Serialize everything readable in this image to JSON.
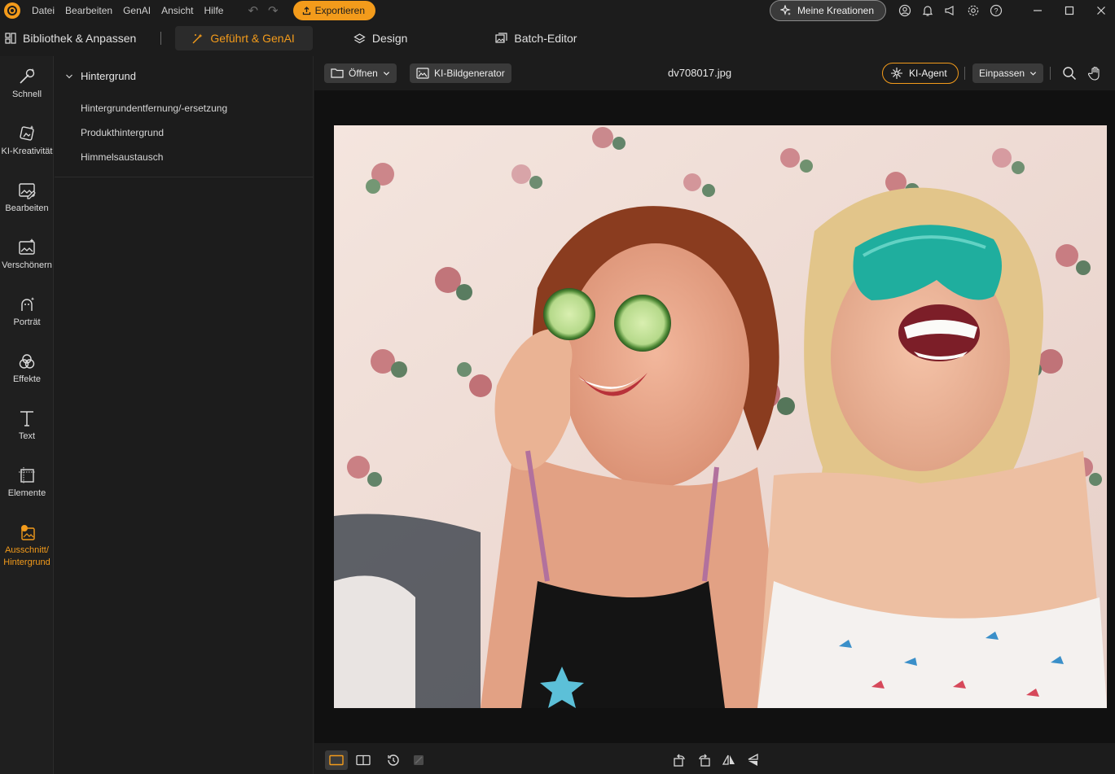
{
  "titlebar": {
    "menu": [
      "Datei",
      "Bearbeiten",
      "GenAI",
      "Ansicht",
      "Hilfe"
    ],
    "export_label": "Exportieren",
    "kreationen_label": "Meine Kreationen"
  },
  "tabs": {
    "library": "Bibliothek & Anpassen",
    "guided": "Geführt & GenAI",
    "design": "Design",
    "batch": "Batch-Editor"
  },
  "rail": {
    "items": [
      {
        "label": "Schnell",
        "icon": "magic-wand-icon"
      },
      {
        "label": "KI-Kreativität",
        "icon": "ai-creativity-icon"
      },
      {
        "label": "Bearbeiten",
        "icon": "edit-image-icon"
      },
      {
        "label": "Verschönern",
        "icon": "beautify-icon"
      },
      {
        "label": "Porträt",
        "icon": "portrait-icon"
      },
      {
        "label": "Effekte",
        "icon": "effects-icon"
      },
      {
        "label": "Text",
        "icon": "text-icon"
      },
      {
        "label": "Elemente",
        "icon": "elements-icon"
      },
      {
        "label": "Ausschnitt/\nHintergrund",
        "icon": "cutout-icon"
      }
    ]
  },
  "panel": {
    "heading": "Hintergrund",
    "items": [
      "Hintergrundentfernung/-ersetzung",
      "Produkthintergrund",
      "Himmelsaustausch"
    ]
  },
  "canvas_toolbar": {
    "open_label": "Öffnen",
    "generator_label": "KI-Bildgenerator",
    "file_name": "dv708017.jpg",
    "agent_label": "KI-Agent",
    "fit_label": "Einpassen"
  },
  "colors": {
    "accent": "#f39b1b",
    "background": "#1c1c1c",
    "canvas": "#111111"
  }
}
